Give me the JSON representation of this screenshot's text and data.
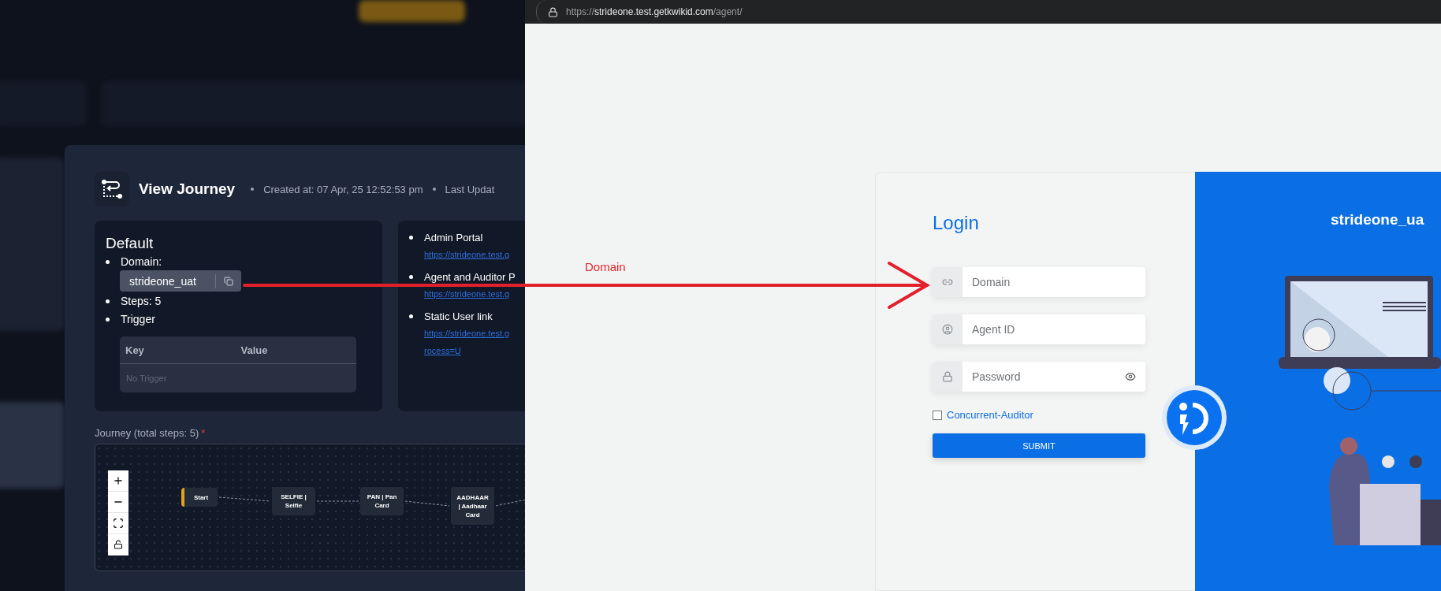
{
  "journey_view": {
    "title": "View Journey",
    "created": "Created at: 07 Apr, 25 12:52:53 pm",
    "updated": "Last Updat"
  },
  "default_card": {
    "title": "Default",
    "domain_label": "Domain:",
    "domain_value": "strideone_uat",
    "steps": "Steps: 5",
    "trigger": "Trigger",
    "table": {
      "columns": [
        "Key",
        "Value"
      ],
      "empty": "No Trigger"
    }
  },
  "links_card": {
    "items": [
      {
        "label": "Admin Portal",
        "link_lines": [
          "https://strideone.test.g"
        ]
      },
      {
        "label": "Agent and Auditor P",
        "link_lines": [
          "https://strideone.test.g"
        ]
      },
      {
        "label": "Static User link",
        "link_lines": [
          "https://strideone.test.g",
          "rocess=U"
        ]
      }
    ]
  },
  "journey": {
    "label": "Journey (total steps: 5)",
    "required_mark": "*",
    "nodes": [
      {
        "kind": "start",
        "lines": [
          "Start"
        ]
      },
      {
        "kind": "step",
        "lines": [
          "SELFIE |",
          "Selfie"
        ]
      },
      {
        "kind": "step",
        "lines": [
          "PAN | Pan",
          "Card"
        ]
      },
      {
        "kind": "step",
        "lines": [
          "AADHAAR",
          "| Aadhaar",
          "Card"
        ]
      }
    ]
  },
  "annotation": {
    "text": "Domain"
  },
  "browser": {
    "url_scheme": "https://",
    "url_host": "strideone.test.getkwikid.com",
    "url_path": "/agent/"
  },
  "login": {
    "title": "Login",
    "fields": [
      {
        "kind": "text",
        "placeholder": "Domain"
      },
      {
        "kind": "text",
        "placeholder": "Agent ID"
      },
      {
        "kind": "password",
        "placeholder": "Password"
      }
    ],
    "checkbox": {
      "label": "Concurrent-Auditor",
      "checked": false
    },
    "submit": "SUBMIT"
  },
  "brand_panel": {
    "title": "strideone_ua"
  }
}
